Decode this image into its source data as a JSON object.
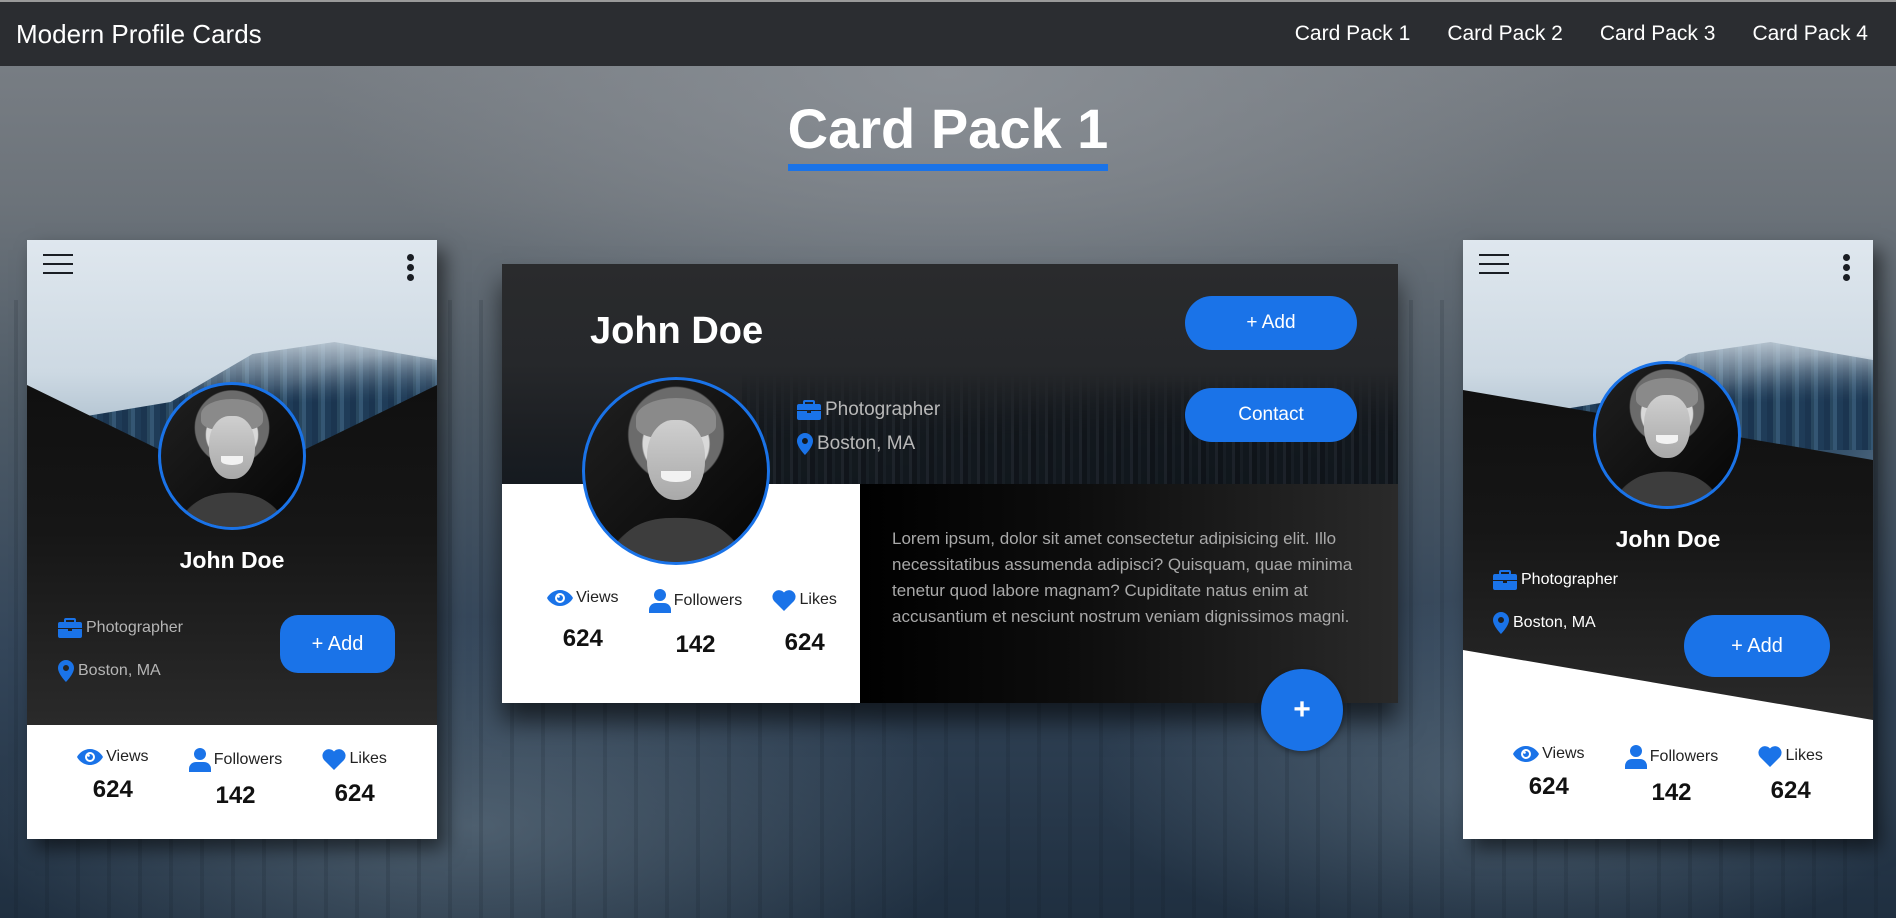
{
  "navbar": {
    "brand": "Modern Profile Cards",
    "links": [
      "Card Pack 1",
      "Card Pack 2",
      "Card Pack 3",
      "Card Pack 4"
    ]
  },
  "section": {
    "title": "Card Pack 1"
  },
  "colors": {
    "accent": "#1a73e8",
    "navbar_bg": "#2b2d31"
  },
  "cards": [
    {
      "name": "John Doe",
      "job": "Photographer",
      "location": "Boston, MA",
      "add_label": "+ Add",
      "icons": [
        "hamburger-menu-icon",
        "kebab-menu-icon",
        "briefcase-icon",
        "map-pin-icon"
      ],
      "stats": [
        {
          "icon": "eye-icon",
          "label": "Views",
          "value": "624"
        },
        {
          "icon": "user-icon",
          "label": "Followers",
          "value": "142"
        },
        {
          "icon": "heart-icon",
          "label": "Likes",
          "value": "624"
        }
      ]
    },
    {
      "name": "John Doe",
      "job": "Photographer",
      "location": "Boston, MA",
      "add_label": "+ Add",
      "contact_label": "Contact",
      "bio": "Lorem ipsum, dolor sit amet consectetur adipisicing elit. Illo necessitatibus assumenda adipisci? Quisquam, quae minima tenetur quod labore magnam? Cupiditate natus enim at accusantium et nesciunt nostrum veniam dignissimos magni.",
      "fab_label": "+",
      "stats": [
        {
          "icon": "eye-icon",
          "label": "Views",
          "value": "624"
        },
        {
          "icon": "user-icon",
          "label": "Followers",
          "value": "142"
        },
        {
          "icon": "heart-icon",
          "label": "Likes",
          "value": "624"
        }
      ]
    },
    {
      "name": "John Doe",
      "job": "Photographer",
      "location": "Boston, MA",
      "add_label": "+ Add",
      "icons": [
        "hamburger-menu-icon",
        "kebab-menu-icon",
        "briefcase-icon",
        "map-pin-icon"
      ],
      "stats": [
        {
          "icon": "eye-icon",
          "label": "Views",
          "value": "624"
        },
        {
          "icon": "user-icon",
          "label": "Followers",
          "value": "142"
        },
        {
          "icon": "heart-icon",
          "label": "Likes",
          "value": "624"
        }
      ]
    }
  ]
}
